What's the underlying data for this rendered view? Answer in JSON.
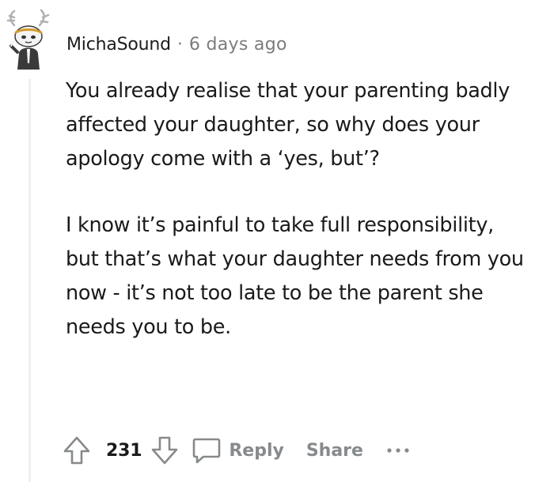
{
  "comment": {
    "username": "MichaSound",
    "separator": "·",
    "timestamp": "6 days ago",
    "paragraphs": [
      "You already realise that your parenting badly affected your daughter, so why does your apology come with a ‘yes, but’?",
      "I know it’s painful to take full responsibility, but that’s what your daughter needs from you now - it’s not too late to be the parent she needs you to be."
    ]
  },
  "actions": {
    "upvote_icon": "arrow-up-outline-icon",
    "vote_count": "231",
    "downvote_icon": "arrow-down-outline-icon",
    "reply_icon": "speech-bubble-icon",
    "reply_label": "Reply",
    "share_label": "Share",
    "more_icon": "ellipsis-icon"
  },
  "colors": {
    "text": "#1a1a1b",
    "muted": "#7c7c7c",
    "action_gray": "#878a8c",
    "thread_line": "#edeff1",
    "icon_gray": "#878a8c"
  }
}
